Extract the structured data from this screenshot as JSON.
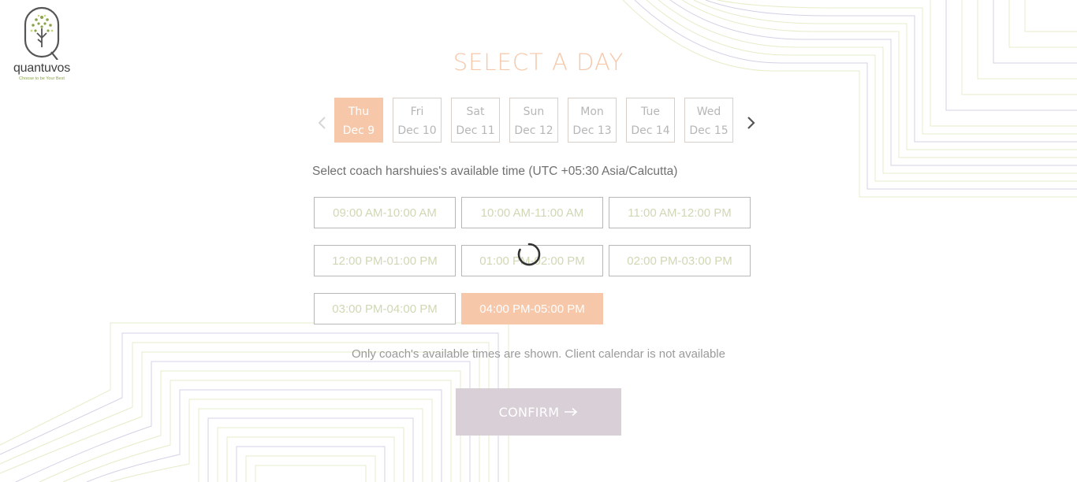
{
  "logo": {
    "name": "quantuvos",
    "tagline": "Choose to be Your Best",
    "icon": "tree-logo-icon"
  },
  "heading": "SELECT A DAY",
  "days": [
    {
      "weekday": "Thu",
      "date": "Dec 9",
      "selected": true
    },
    {
      "weekday": "Fri",
      "date": "Dec 10",
      "selected": false
    },
    {
      "weekday": "Sat",
      "date": "Dec 11",
      "selected": false
    },
    {
      "weekday": "Sun",
      "date": "Dec 12",
      "selected": false
    },
    {
      "weekday": "Mon",
      "date": "Dec 13",
      "selected": false
    },
    {
      "weekday": "Tue",
      "date": "Dec 14",
      "selected": false
    },
    {
      "weekday": "Wed",
      "date": "Dec 15",
      "selected": false
    }
  ],
  "nav": {
    "prev_icon": "chevron-left-icon",
    "next_icon": "chevron-right-icon"
  },
  "availability_text": "Select coach harshuies's available time (UTC +05:30 Asia/Calcutta)",
  "time_slots": [
    {
      "label": "09:00 AM-10:00 AM",
      "selected": false
    },
    {
      "label": "10:00 AM-11:00 AM",
      "selected": false
    },
    {
      "label": "11:00 AM-12:00 PM",
      "selected": false
    },
    {
      "label": "12:00 PM-01:00 PM",
      "selected": false
    },
    {
      "label": "01:00 PM-02:00 PM",
      "selected": false
    },
    {
      "label": "02:00 PM-03:00 PM",
      "selected": false
    },
    {
      "label": "03:00 PM-04:00 PM",
      "selected": false
    },
    {
      "label": "04:00 PM-05:00 PM",
      "selected": true
    }
  ],
  "loading_icon": "spinner-icon",
  "note": "Only coach's available times are shown. Client calendar is not available",
  "confirm": {
    "label": "CONFIRM",
    "icon": "arrow-right-icon"
  },
  "colors": {
    "accent": "#f6c7a9",
    "confirm_bg": "#d9cfd6",
    "slot_text": "#cfd8b4",
    "deco_green": "#e6ecc8",
    "deco_purple": "#d6d0e6"
  }
}
